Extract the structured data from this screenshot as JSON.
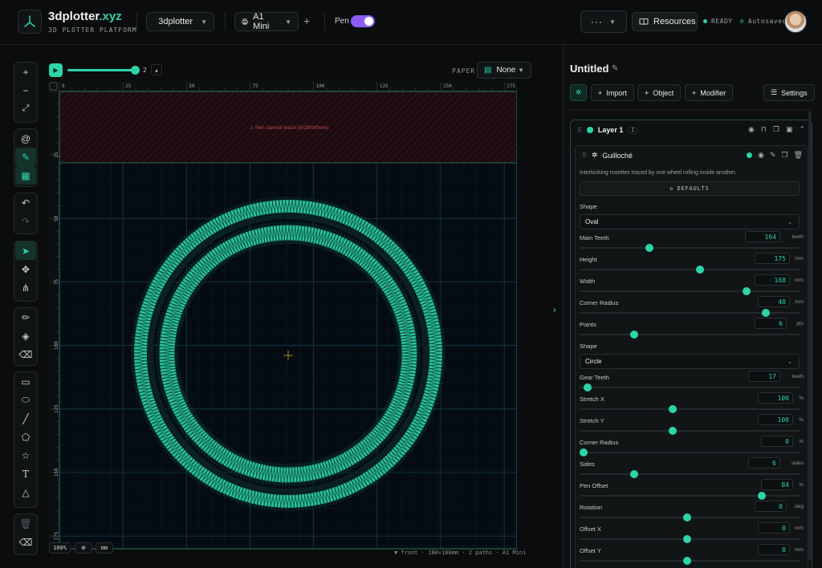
{
  "app": {
    "brand": "3dplotter",
    "brand_tld": ".xyz",
    "tagline": "3D PLOTTER PLATFORM",
    "workspace": "3dplotter",
    "machine": "A1 Mini",
    "pen_label": "Pen",
    "pen_enabled": true,
    "more_label": "···",
    "resources_label": "Resources",
    "status_ready": "READY",
    "status_saved": "Autosaved"
  },
  "canvas": {
    "speed_value": "2",
    "speed_fraction": 0.98,
    "paper_label": "PAPER",
    "paper_value": "None",
    "warning": "⚠ Pen cannot reach (0/28/0/0mm)",
    "ruler_top": [
      "0",
      "25",
      "50",
      "75",
      "100",
      "125",
      "150",
      "175"
    ],
    "ruler_left": [
      "25",
      "50",
      "75",
      "100",
      "125",
      "150",
      "175"
    ],
    "zoom": "100%",
    "unit": "mm",
    "footer": "▼ front · 180×180mm · 2 paths · A1 Mini"
  },
  "panel": {
    "title": "Untitled",
    "btn_import": "Import",
    "btn_object": "Object",
    "btn_modifier": "Modifier",
    "btn_settings": "Settings",
    "layer_name": "Layer 1",
    "layer_count": "1",
    "modifier_name": "Guilloché",
    "modifier_desc": "Interlocking rosettes traced by one wheel rolling inside another.",
    "defaults_label": "DEFAULTS",
    "shape1_label": "Shape",
    "shape1_value": "Oval",
    "shape2_label": "Shape",
    "shape2_value": "Circle",
    "params": [
      {
        "label": "Main Teeth",
        "value": "164",
        "unit": "teeth",
        "fraction": 0.31
      },
      {
        "label": "Height",
        "value": "175",
        "unit": "mm",
        "fraction": 0.55
      },
      {
        "label": "Width",
        "value": "168",
        "unit": "mm",
        "fraction": 0.77
      },
      {
        "label": "Corner Radius",
        "value": "40",
        "unit": "mm",
        "fraction": 0.86
      },
      {
        "label": "Points",
        "value": "6",
        "unit": "pts",
        "fraction": 0.24
      },
      {
        "label": "Gear Teeth",
        "value": "17",
        "unit": "teeth",
        "fraction": 0.02
      },
      {
        "label": "Stretch X",
        "value": "100",
        "unit": "%",
        "fraction": 0.42
      },
      {
        "label": "Stretch Y",
        "value": "100",
        "unit": "%",
        "fraction": 0.42
      },
      {
        "label": "Corner Radius",
        "value": "0",
        "unit": "%",
        "fraction": 0.0
      },
      {
        "label": "Sides",
        "value": "6",
        "unit": "sides",
        "fraction": 0.24
      },
      {
        "label": "Pen Offset",
        "value": "84",
        "unit": "%",
        "fraction": 0.84
      },
      {
        "label": "Rotation",
        "value": "0",
        "unit": "deg",
        "fraction": 0.49
      },
      {
        "label": "Offset X",
        "value": "0",
        "unit": "mm",
        "fraction": 0.49
      },
      {
        "label": "Offset Y",
        "value": "0",
        "unit": "mm",
        "fraction": 0.49
      }
    ]
  },
  "colors": {
    "accent": "#2dd4a8",
    "pen_toggle": "#8b5cf6",
    "warning": "#e05252"
  }
}
